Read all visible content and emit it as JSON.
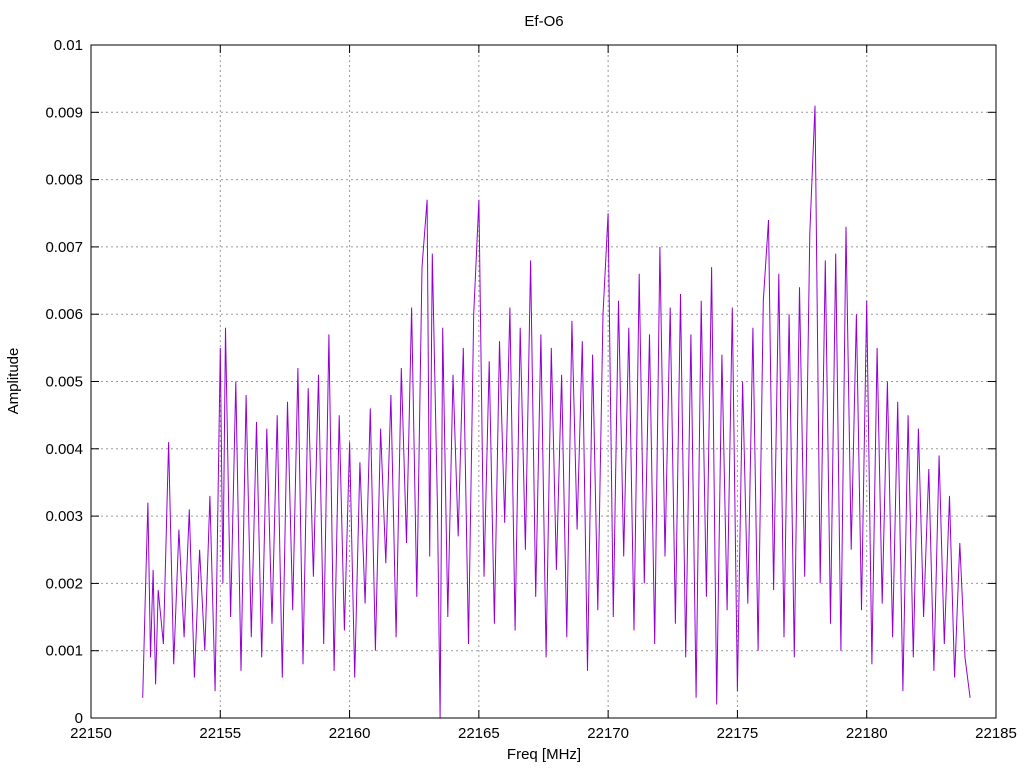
{
  "chart_data": {
    "type": "line",
    "title": "Ef-O6",
    "xlabel": "Freq [MHz]",
    "ylabel": "Amplitude",
    "xlim": [
      22150,
      22185
    ],
    "ylim": [
      0,
      0.01
    ],
    "xticks": [
      "22150",
      "22155",
      "22160",
      "22165",
      "22170",
      "22175",
      "22180",
      "22185"
    ],
    "yticks": [
      "0",
      "0.001",
      "0.002",
      "0.003",
      "0.004",
      "0.005",
      "0.006",
      "0.007",
      "0.008",
      "0.009",
      "0.01"
    ],
    "grid": true,
    "series": [
      {
        "color": "#9400d3",
        "x": [
          22152.0,
          22152.1,
          22152.2,
          22152.3,
          22152.4,
          22152.5,
          22152.6,
          22152.8,
          22153.0,
          22153.2,
          22153.4,
          22153.6,
          22153.8,
          22154.0,
          22154.2,
          22154.4,
          22154.6,
          22154.8,
          22155.0,
          22155.1,
          22155.2,
          22155.4,
          22155.6,
          22155.8,
          22156.0,
          22156.2,
          22156.4,
          22156.6,
          22156.8,
          22157.0,
          22157.2,
          22157.4,
          22157.6,
          22157.8,
          22158.0,
          22158.2,
          22158.4,
          22158.6,
          22158.8,
          22159.0,
          22159.2,
          22159.4,
          22159.6,
          22159.8,
          22160.0,
          22160.2,
          22160.4,
          22160.6,
          22160.8,
          22161.0,
          22161.2,
          22161.4,
          22161.6,
          22161.8,
          22162.0,
          22162.2,
          22162.4,
          22162.6,
          22162.8,
          22163.0,
          22163.1,
          22163.2,
          22163.4,
          22163.5,
          22163.6,
          22163.8,
          22164.0,
          22164.2,
          22164.4,
          22164.6,
          22164.8,
          22165.0,
          22165.2,
          22165.4,
          22165.6,
          22165.8,
          22166.0,
          22166.2,
          22166.4,
          22166.6,
          22166.8,
          22167.0,
          22167.2,
          22167.4,
          22167.6,
          22167.8,
          22168.0,
          22168.2,
          22168.4,
          22168.6,
          22168.8,
          22169.0,
          22169.2,
          22169.4,
          22169.6,
          22169.8,
          22170.0,
          22170.2,
          22170.4,
          22170.6,
          22170.8,
          22171.0,
          22171.2,
          22171.4,
          22171.6,
          22171.8,
          22172.0,
          22172.2,
          22172.4,
          22172.6,
          22172.8,
          22173.0,
          22173.2,
          22173.4,
          22173.6,
          22173.8,
          22174.0,
          22174.2,
          22174.4,
          22174.6,
          22174.8,
          22175.0,
          22175.2,
          22175.4,
          22175.6,
          22175.8,
          22176.0,
          22176.2,
          22176.4,
          22176.6,
          22176.8,
          22177.0,
          22177.2,
          22177.4,
          22177.6,
          22177.8,
          22178.0,
          22178.2,
          22178.4,
          22178.6,
          22178.8,
          22179.0,
          22179.2,
          22179.4,
          22179.6,
          22179.8,
          22180.0,
          22180.2,
          22180.4,
          22180.6,
          22180.8,
          22181.0,
          22181.2,
          22181.4,
          22181.6,
          22181.8,
          22182.0,
          22182.2,
          22182.4,
          22182.6,
          22182.8,
          22183.0,
          22183.2,
          22183.4,
          22183.6,
          22183.8,
          22184.0
        ],
        "y": [
          0.0003,
          0.0018,
          0.0032,
          0.0009,
          0.0022,
          0.0005,
          0.0019,
          0.0011,
          0.0041,
          0.0008,
          0.0028,
          0.0012,
          0.0031,
          0.0006,
          0.0025,
          0.001,
          0.0033,
          0.0004,
          0.0055,
          0.002,
          0.0058,
          0.0015,
          0.005,
          0.0007,
          0.0048,
          0.0012,
          0.0044,
          0.0009,
          0.0043,
          0.0014,
          0.0045,
          0.0006,
          0.0047,
          0.0016,
          0.0052,
          0.0008,
          0.0049,
          0.0021,
          0.0051,
          0.0011,
          0.0057,
          0.0007,
          0.0045,
          0.0013,
          0.0041,
          0.0006,
          0.0038,
          0.0017,
          0.0046,
          0.001,
          0.0043,
          0.0023,
          0.0048,
          0.0012,
          0.0052,
          0.0026,
          0.0061,
          0.0018,
          0.0067,
          0.0077,
          0.0024,
          0.0069,
          0.0031,
          0.0,
          0.0058,
          0.0015,
          0.0051,
          0.0027,
          0.0055,
          0.0011,
          0.006,
          0.0077,
          0.0021,
          0.0053,
          0.0014,
          0.0056,
          0.0029,
          0.0061,
          0.0013,
          0.0058,
          0.0025,
          0.0068,
          0.0018,
          0.0057,
          0.0009,
          0.0055,
          0.0022,
          0.0051,
          0.0012,
          0.0059,
          0.0028,
          0.0056,
          0.0007,
          0.0054,
          0.0016,
          0.006,
          0.0075,
          0.0015,
          0.0062,
          0.0024,
          0.0058,
          0.0013,
          0.0066,
          0.002,
          0.0057,
          0.0011,
          0.007,
          0.0024,
          0.0061,
          0.0014,
          0.0063,
          0.0009,
          0.0057,
          0.0003,
          0.0062,
          0.0018,
          0.0067,
          0.0002,
          0.0054,
          0.0016,
          0.0061,
          0.0004,
          0.005,
          0.0017,
          0.0058,
          0.001,
          0.0062,
          0.0074,
          0.0019,
          0.0066,
          0.0012,
          0.006,
          0.0009,
          0.0064,
          0.0021,
          0.0072,
          0.0091,
          0.002,
          0.0068,
          0.0014,
          0.0069,
          0.001,
          0.0073,
          0.0025,
          0.006,
          0.0016,
          0.0062,
          0.0008,
          0.0055,
          0.0017,
          0.005,
          0.0012,
          0.0047,
          0.0004,
          0.0045,
          0.0009,
          0.0043,
          0.0015,
          0.0037,
          0.0007,
          0.0039,
          0.0011,
          0.0033,
          0.0006,
          0.0026,
          0.0009,
          0.0003
        ]
      }
    ]
  }
}
